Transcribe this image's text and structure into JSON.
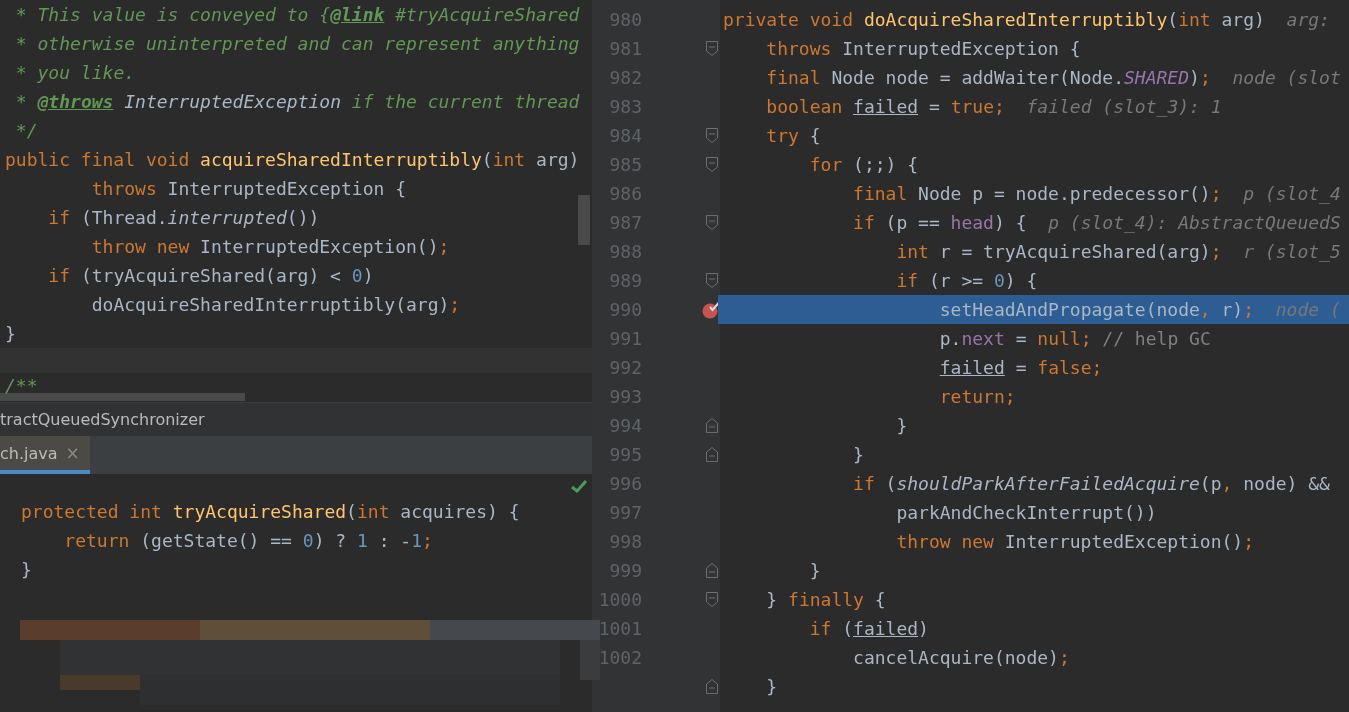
{
  "left_editor": {
    "lines": [
      {
        "tokens": [
          {
            "kind": "cm",
            "text": " * This value is conveyed to {"
          },
          {
            "kind": "tag",
            "text": "@link"
          },
          {
            "kind": "cm",
            "text": " #tryAcquireShared"
          }
        ]
      },
      {
        "tokens": [
          {
            "kind": "cm",
            "text": " * otherwise uninterpreted and can represent anything"
          }
        ]
      },
      {
        "tokens": [
          {
            "kind": "cm",
            "text": " * you like."
          }
        ]
      },
      {
        "tokens": [
          {
            "kind": "cm",
            "text": " * "
          },
          {
            "kind": "tag",
            "text": "@throws"
          },
          {
            "kind": "cmr",
            "text": " InterruptedException"
          },
          {
            "kind": "cm",
            "text": " if the current thread"
          }
        ]
      },
      {
        "tokens": [
          {
            "kind": "cm",
            "text": " */"
          }
        ]
      },
      {
        "tokens": [
          {
            "kind": "kw",
            "text": "public final void "
          },
          {
            "kind": "fn",
            "text": "acquireSharedInterruptibly"
          },
          {
            "kind": "tx",
            "text": "("
          },
          {
            "kind": "kw",
            "text": "int "
          },
          {
            "kind": "tx",
            "text": "arg)"
          }
        ]
      },
      {
        "tokens": [
          {
            "kind": "kw",
            "text": "        throws "
          },
          {
            "kind": "tx",
            "text": "InterruptedException {"
          }
        ]
      },
      {
        "tokens": [
          {
            "kind": "kw",
            "text": "    if "
          },
          {
            "kind": "tx",
            "text": "(Thread."
          },
          {
            "kind": "it",
            "text": "interrupted"
          },
          {
            "kind": "tx",
            "text": "())"
          }
        ]
      },
      {
        "tokens": [
          {
            "kind": "kw",
            "text": "        throw new "
          },
          {
            "kind": "tx",
            "text": "InterruptedException()"
          },
          {
            "kind": "kw",
            "text": ";"
          }
        ]
      },
      {
        "tokens": [
          {
            "kind": "kw",
            "text": "    if "
          },
          {
            "kind": "tx",
            "text": "(tryAcquireShared(arg) < "
          },
          {
            "kind": "num",
            "text": "0"
          },
          {
            "kind": "tx",
            "text": ")"
          }
        ]
      },
      {
        "tokens": [
          {
            "kind": "tx",
            "text": "        doAcquireSharedInterruptibly(arg)"
          },
          {
            "kind": "kw",
            "text": ";"
          }
        ]
      },
      {
        "tokens": [
          {
            "kind": "tx",
            "text": "}"
          }
        ]
      }
    ],
    "after_line": {
      "tokens": [
        {
          "kind": "cm",
          "text": "/**"
        }
      ]
    }
  },
  "breadcrumb": "tractQueuedSynchronizer",
  "tabs": [
    {
      "label": "ch.java",
      "close": "×",
      "selected": true
    }
  ],
  "bottom_editor": {
    "lines": [
      {
        "tokens": [
          {
            "kind": "kw",
            "text": "protected int "
          },
          {
            "kind": "fn",
            "text": "tryAcquireShared"
          },
          {
            "kind": "tx",
            "text": "("
          },
          {
            "kind": "kw",
            "text": "int "
          },
          {
            "kind": "tx",
            "text": "acquires) {"
          }
        ]
      },
      {
        "tokens": [
          {
            "kind": "kw",
            "text": "    return "
          },
          {
            "kind": "tx",
            "text": "(getState() == "
          },
          {
            "kind": "num",
            "text": "0"
          },
          {
            "kind": "tx",
            "text": ") ? "
          },
          {
            "kind": "num",
            "text": "1"
          },
          {
            "kind": "tx",
            "text": " : -"
          },
          {
            "kind": "num",
            "text": "1"
          },
          {
            "kind": "kw",
            "text": ";"
          }
        ]
      },
      {
        "tokens": [
          {
            "kind": "tx",
            "text": "}"
          }
        ]
      }
    ]
  },
  "right_editor": {
    "lines": [
      {
        "number": "980",
        "kind": "plain",
        "breakpoint": false,
        "current": false,
        "tokens": [
          {
            "kind": "kw",
            "text": "private void "
          },
          {
            "kind": "fn",
            "text": "doAcquireSharedInterruptibly"
          },
          {
            "kind": "tx",
            "text": "("
          },
          {
            "kind": "kw",
            "text": "int "
          },
          {
            "kind": "tx",
            "text": "arg)"
          },
          {
            "kind": "hint",
            "text": "  arg:"
          }
        ]
      },
      {
        "number": "981",
        "kind": "fold-start",
        "breakpoint": false,
        "current": false,
        "tokens": [
          {
            "kind": "kw",
            "text": "    throws "
          },
          {
            "kind": "tx",
            "text": "InterruptedException {"
          }
        ]
      },
      {
        "number": "982",
        "kind": "plain",
        "breakpoint": false,
        "current": false,
        "tokens": [
          {
            "kind": "kw",
            "text": "    final "
          },
          {
            "kind": "tx",
            "text": "Node node = addWaiter(Node."
          },
          {
            "kind": "sfld",
            "text": "SHARED"
          },
          {
            "kind": "tx",
            "text": ")"
          },
          {
            "kind": "kw",
            "text": ";"
          },
          {
            "kind": "hint",
            "text": "  node (slot"
          }
        ]
      },
      {
        "number": "983",
        "kind": "plain",
        "breakpoint": false,
        "current": false,
        "tokens": [
          {
            "kind": "kw",
            "text": "    boolean "
          },
          {
            "kind": "und",
            "text": "failed"
          },
          {
            "kind": "tx",
            "text": " = "
          },
          {
            "kind": "kw",
            "text": "true;"
          },
          {
            "kind": "hint",
            "text": "  failed (slot_3): 1"
          }
        ]
      },
      {
        "number": "984",
        "kind": "fold-start",
        "breakpoint": false,
        "current": false,
        "tokens": [
          {
            "kind": "kw",
            "text": "    try "
          },
          {
            "kind": "tx",
            "text": "{"
          }
        ]
      },
      {
        "number": "985",
        "kind": "fold-start",
        "breakpoint": false,
        "current": false,
        "tokens": [
          {
            "kind": "kw",
            "text": "        for "
          },
          {
            "kind": "tx",
            "text": "(;;) {"
          }
        ]
      },
      {
        "number": "986",
        "kind": "plain",
        "breakpoint": false,
        "current": false,
        "tokens": [
          {
            "kind": "kw",
            "text": "            final "
          },
          {
            "kind": "tx",
            "text": "Node p = node.predecessor()"
          },
          {
            "kind": "kw",
            "text": ";"
          },
          {
            "kind": "hint",
            "text": "  p (slot_4"
          }
        ]
      },
      {
        "number": "987",
        "kind": "fold-start",
        "breakpoint": false,
        "current": false,
        "tokens": [
          {
            "kind": "kw",
            "text": "            if "
          },
          {
            "kind": "tx",
            "text": "(p == "
          },
          {
            "kind": "fld",
            "text": "head"
          },
          {
            "kind": "tx",
            "text": ") {"
          },
          {
            "kind": "hint",
            "text": "  p (slot_4): AbstractQueuedS"
          }
        ]
      },
      {
        "number": "988",
        "kind": "plain",
        "breakpoint": false,
        "current": false,
        "tokens": [
          {
            "kind": "kw",
            "text": "                int "
          },
          {
            "kind": "tx",
            "text": "r = tryAcquireShared(arg)"
          },
          {
            "kind": "kw",
            "text": ";"
          },
          {
            "kind": "hint",
            "text": "  r (slot_5"
          }
        ]
      },
      {
        "number": "989",
        "kind": "fold-start",
        "breakpoint": false,
        "current": false,
        "tokens": [
          {
            "kind": "kw",
            "text": "                if "
          },
          {
            "kind": "tx",
            "text": "(r >= "
          },
          {
            "kind": "num",
            "text": "0"
          },
          {
            "kind": "tx",
            "text": ") {"
          }
        ]
      },
      {
        "number": "990",
        "kind": "plain",
        "breakpoint": true,
        "current": true,
        "tokens": [
          {
            "kind": "tx",
            "text": "                    setHeadAndPropagate(node"
          },
          {
            "kind": "kw",
            "text": ", "
          },
          {
            "kind": "tx",
            "text": "r)"
          },
          {
            "kind": "kw",
            "text": ";"
          },
          {
            "kind": "hint",
            "text": "  node ("
          }
        ]
      },
      {
        "number": "991",
        "kind": "plain",
        "breakpoint": false,
        "current": false,
        "tokens": [
          {
            "kind": "tx",
            "text": "                    p."
          },
          {
            "kind": "fld",
            "text": "next"
          },
          {
            "kind": "tx",
            "text": " = "
          },
          {
            "kind": "kw",
            "text": "null; "
          },
          {
            "kind": "lc",
            "text": "// help GC"
          }
        ]
      },
      {
        "number": "992",
        "kind": "plain",
        "breakpoint": false,
        "current": false,
        "tokens": [
          {
            "kind": "und",
            "text": "                    failed"
          },
          {
            "kind": "tx",
            "text": " = "
          },
          {
            "kind": "kw",
            "text": "false;"
          }
        ]
      },
      {
        "number": "993",
        "kind": "plain",
        "breakpoint": false,
        "current": false,
        "tokens": [
          {
            "kind": "kw",
            "text": "                    return;"
          }
        ]
      },
      {
        "number": "994",
        "kind": "fold-end",
        "breakpoint": false,
        "current": false,
        "tokens": [
          {
            "kind": "tx",
            "text": "                }"
          }
        ]
      },
      {
        "number": "995",
        "kind": "fold-end",
        "breakpoint": false,
        "current": false,
        "tokens": [
          {
            "kind": "tx",
            "text": "            }"
          }
        ]
      },
      {
        "number": "996",
        "kind": "plain",
        "breakpoint": false,
        "current": false,
        "tokens": [
          {
            "kind": "kw",
            "text": "            if "
          },
          {
            "kind": "tx",
            "text": "("
          },
          {
            "kind": "it",
            "text": "shouldParkAfterFailedAcquire"
          },
          {
            "kind": "tx",
            "text": "(p"
          },
          {
            "kind": "kw",
            "text": ", "
          },
          {
            "kind": "tx",
            "text": "node) &&"
          }
        ]
      },
      {
        "number": "997",
        "kind": "plain",
        "breakpoint": false,
        "current": false,
        "tokens": [
          {
            "kind": "tx",
            "text": "                parkAndCheckInterrupt())"
          }
        ]
      },
      {
        "number": "998",
        "kind": "plain",
        "breakpoint": false,
        "current": false,
        "tokens": [
          {
            "kind": "kw",
            "text": "                throw new "
          },
          {
            "kind": "tx",
            "text": "InterruptedException()"
          },
          {
            "kind": "kw",
            "text": ";"
          }
        ]
      },
      {
        "number": "999",
        "kind": "fold-end",
        "breakpoint": false,
        "current": false,
        "tokens": [
          {
            "kind": "tx",
            "text": "        }"
          }
        ]
      },
      {
        "number": "1000",
        "kind": "fold-start",
        "breakpoint": false,
        "current": false,
        "tokens": [
          {
            "kind": "tx",
            "text": "    } "
          },
          {
            "kind": "kw",
            "text": "finally "
          },
          {
            "kind": "tx",
            "text": "{"
          }
        ]
      },
      {
        "number": "1001",
        "kind": "plain",
        "breakpoint": false,
        "current": false,
        "tokens": [
          {
            "kind": "kw",
            "text": "        if "
          },
          {
            "kind": "tx",
            "text": "("
          },
          {
            "kind": "und",
            "text": "failed"
          },
          {
            "kind": "tx",
            "text": ")"
          }
        ]
      },
      {
        "number": "1002",
        "kind": "plain",
        "breakpoint": false,
        "current": false,
        "tokens": [
          {
            "kind": "tx",
            "text": "            cancelAcquire(node)"
          },
          {
            "kind": "kw",
            "text": ";"
          }
        ]
      },
      {
        "kind": "fold-end",
        "breakpoint": false,
        "current": false,
        "tokens": [
          {
            "kind": "tx",
            "text": "    }"
          }
        ]
      }
    ]
  }
}
